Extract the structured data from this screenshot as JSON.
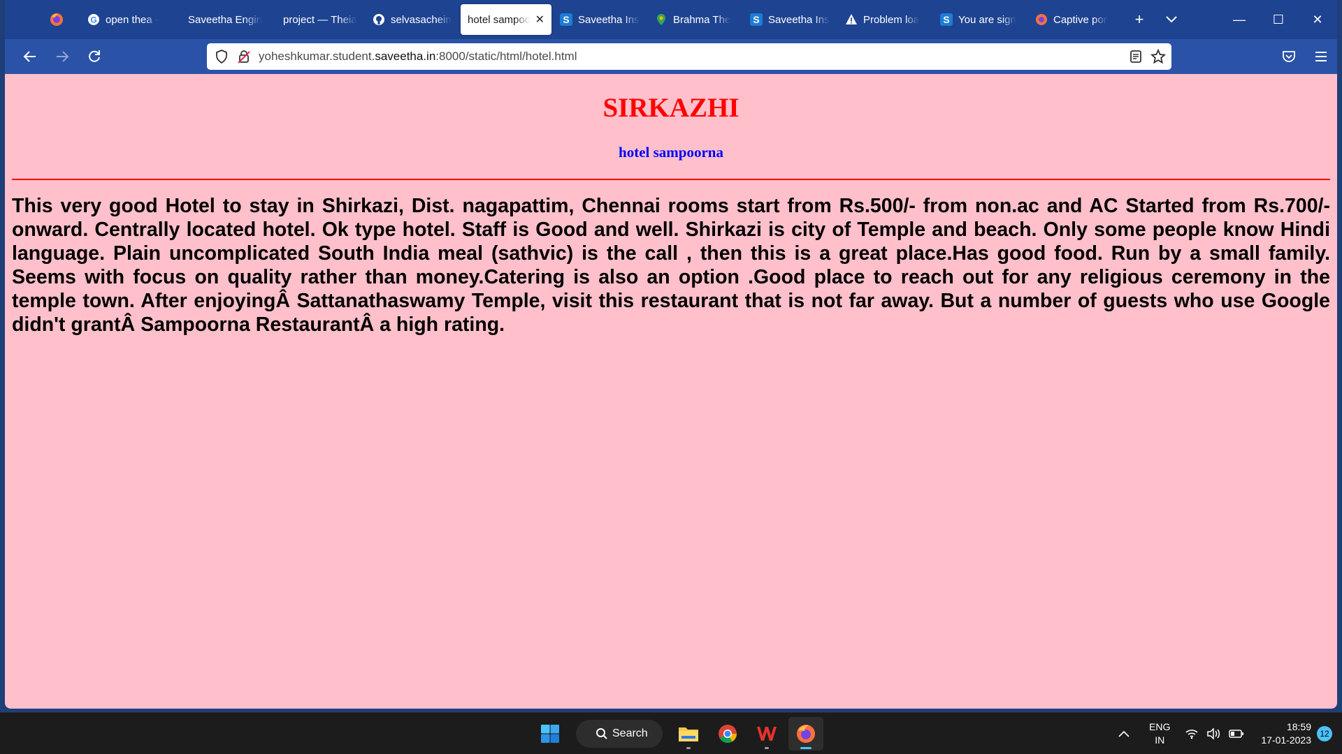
{
  "browser": {
    "tabs": [
      {
        "label": "open thea -",
        "icon": "google-icon",
        "active": false
      },
      {
        "label": "Saveetha Engine",
        "icon": "",
        "active": false
      },
      {
        "label": "project — Theia",
        "icon": "",
        "active": false
      },
      {
        "label": "selvasachein",
        "icon": "github-icon",
        "active": false
      },
      {
        "label": "hotel sampoo",
        "icon": "",
        "active": true
      },
      {
        "label": "Saveetha Ins",
        "icon": "saveetha-s-icon",
        "active": false
      },
      {
        "label": "Brahma The",
        "icon": "maps-pin-icon",
        "active": false
      },
      {
        "label": "Saveetha Ins",
        "icon": "saveetha-s-icon",
        "active": false
      },
      {
        "label": "Problem loa",
        "icon": "warning-icon",
        "active": false
      },
      {
        "label": "You are sign",
        "icon": "saveetha-s-icon",
        "active": false
      },
      {
        "label": "Captive por",
        "icon": "firefox-icon",
        "active": false
      }
    ],
    "url_prefix": "yoheshkumar.student.",
    "url_domain": "saveetha.in",
    "url_suffix": ":8000/static/html/hotel.html"
  },
  "page": {
    "heading": "SIRKAZHI",
    "subheading": "hotel sampoorna",
    "body_text": "This very good Hotel to stay in Shirkazi, Dist. nagapattim, Chennai rooms start from Rs.500/- from non.ac and AC Started from Rs.700/- onward. Centrally located hotel. Ok type hotel. Staff is Good and well. Shirkazi is city of Temple and beach. Only some people know Hindi language. Plain uncomplicated South India meal (sathvic) is the call , then this is a great place.Has good food. Run by a small family. Seems with focus on quality rather than money.Catering is also an option .Good place to reach out for any religious ceremony in the temple town. After enjoyingÂ Sattanathaswamy Temple, visit this restaurant that is not far away. But a number of guests who use Google didn't grantÂ Sampoorna RestaurantÂ a high rating.",
    "colors": {
      "background": "#ffc0cb",
      "heading": "#ff0000",
      "subheading": "#0000ff",
      "rule": "#ff0000"
    }
  },
  "taskbar": {
    "search_label": "Search",
    "lang_line1": "ENG",
    "lang_line2": "IN",
    "time": "18:59",
    "date": "17-01-2023",
    "notification_count": "12"
  }
}
